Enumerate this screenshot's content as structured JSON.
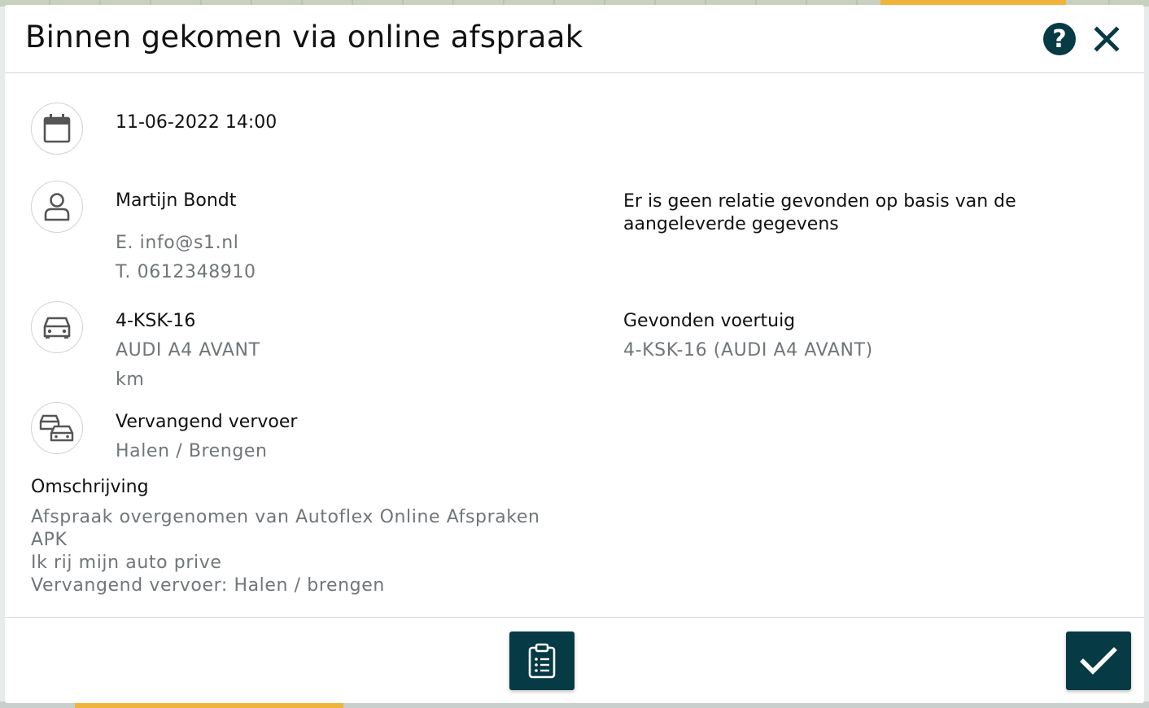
{
  "modal": {
    "title": "Binnen gekomen via online afspraak",
    "help_label": "?"
  },
  "appointment": {
    "datetime": "11-06-2022 14:00"
  },
  "customer": {
    "name": "Martijn Bondt",
    "email": "E. info@s1.nl",
    "phone": "T. 0612348910",
    "relation_message": "Er is geen relatie gevonden op basis van de aangeleverde gegevens"
  },
  "vehicle": {
    "plate": "4-KSK-16",
    "model": "AUDI A4 AVANT",
    "km": "km",
    "found_label": "Gevonden voertuig",
    "found_value": "4-KSK-16 (AUDI A4 AVANT)"
  },
  "replacement": {
    "label": "Vervangend vervoer",
    "value": "Halen / Brengen"
  },
  "description": {
    "label": "Omschrijving",
    "lines": [
      "Afspraak overgenomen van Autoflex Online Afspraken",
      "APK",
      "Ik rij mijn auto prive",
      "Vervangend vervoer: Halen / brengen"
    ]
  },
  "icons": {
    "datetime": "calendar-icon",
    "customer": "user-icon",
    "vehicle": "car-icon",
    "replacement": "cars-icon",
    "help": "question-icon",
    "close": "close-icon",
    "checklist": "clipboard-list-icon",
    "confirm": "check-icon"
  },
  "colors": {
    "primary": "#063a45",
    "muted_text": "#707679",
    "border": "#d6d9db"
  }
}
